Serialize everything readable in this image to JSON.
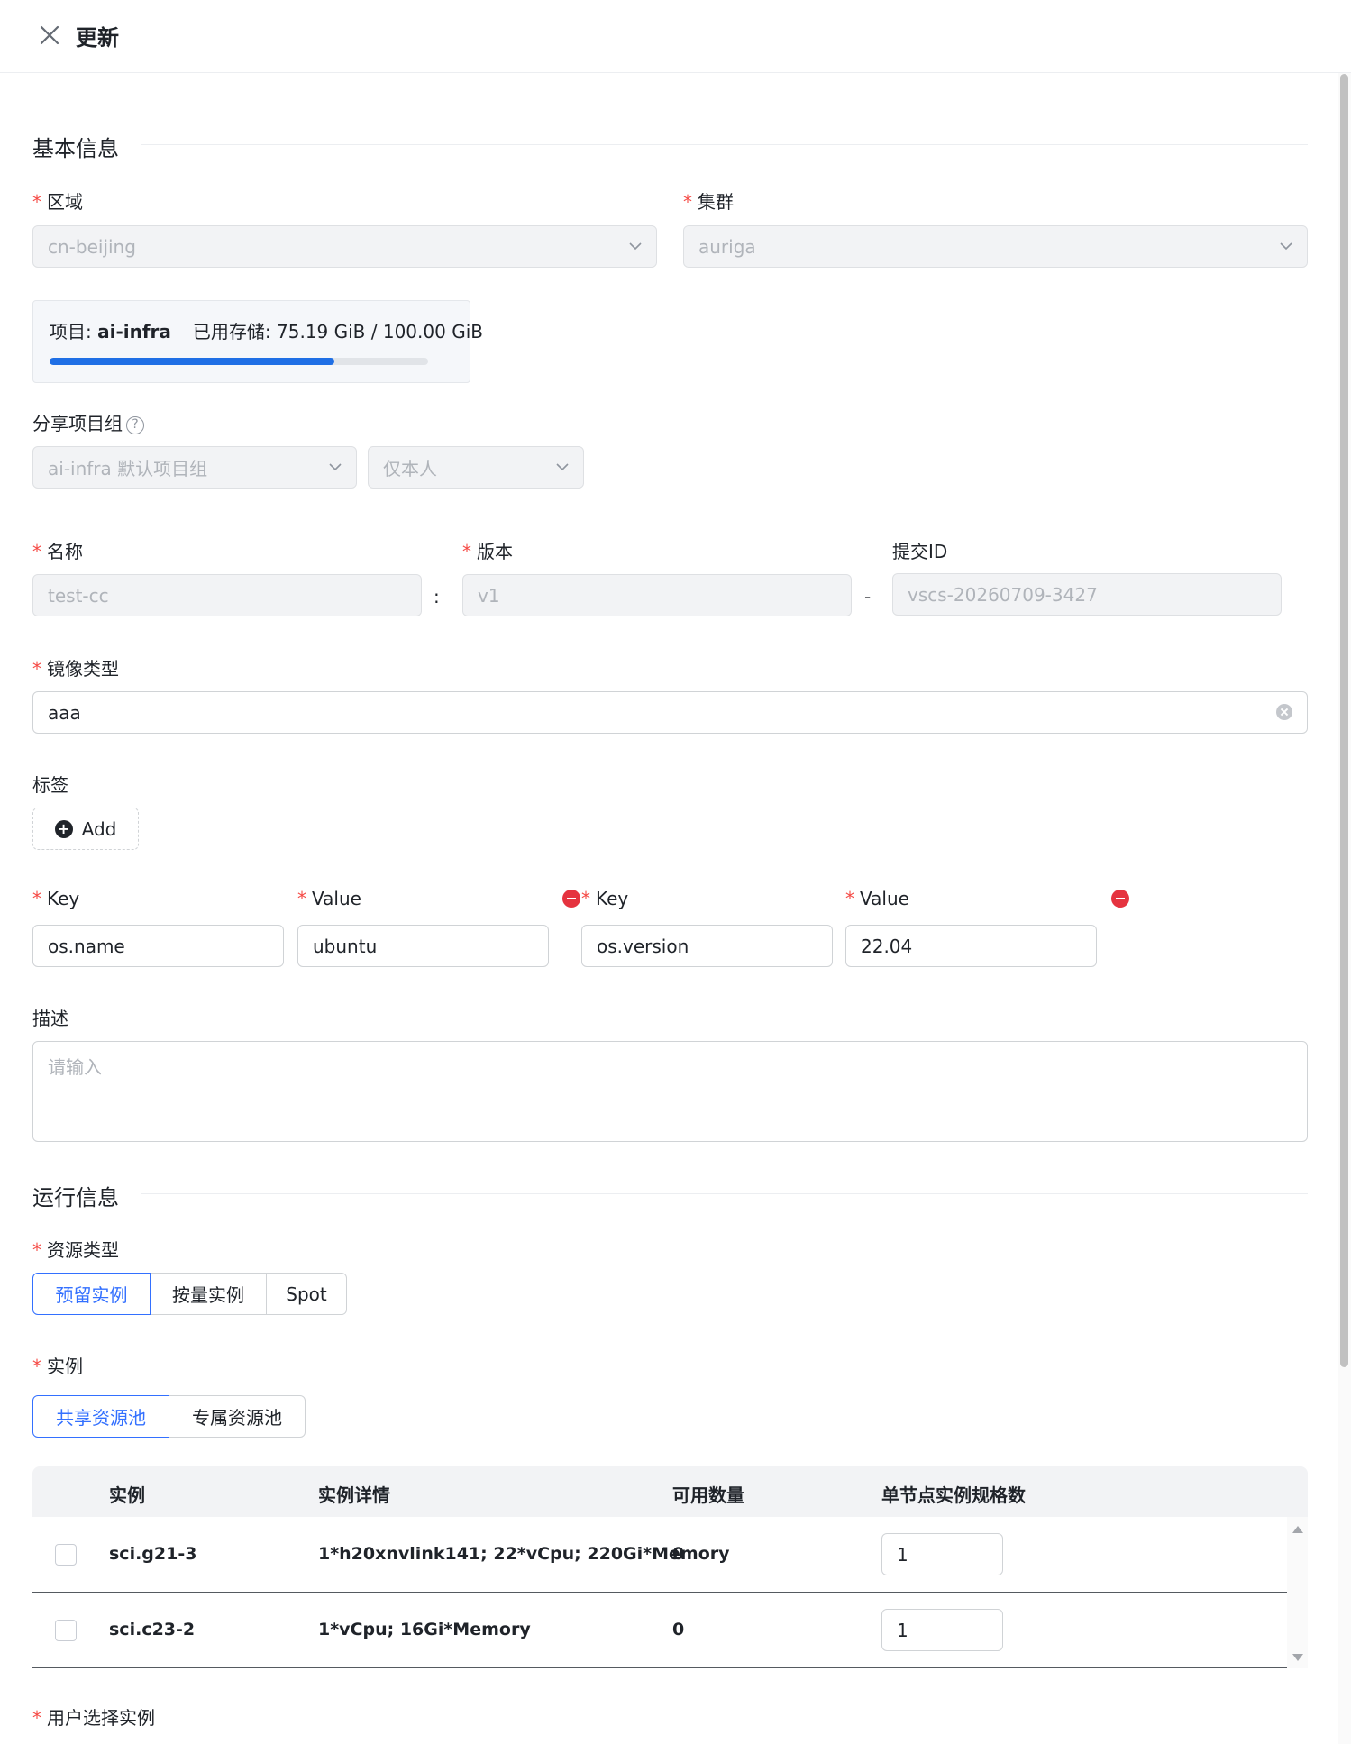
{
  "header": {
    "title": "更新"
  },
  "basic_section": {
    "title": "基本信息"
  },
  "region": {
    "label": "区域",
    "value": "cn-beijing"
  },
  "cluster": {
    "label": "集群",
    "value": "auriga"
  },
  "quota": {
    "project_label": "项目: ",
    "project_name": "ai-infra",
    "storage_text": "已用存储: 75.19 GiB / 100.00 GiB",
    "used_fraction": 0.7519
  },
  "share_group": {
    "label": "分享项目组",
    "group_value": "ai-infra 默认项目组",
    "scope_value": "仅本人"
  },
  "name": {
    "label": "名称",
    "value": "test-cc"
  },
  "version": {
    "label": "版本",
    "value": "v1"
  },
  "commit": {
    "label": "提交ID",
    "value": "vscs-20260709-3427"
  },
  "separators": {
    "colon": ":",
    "dash": "-"
  },
  "image_type": {
    "label": "镜像类型",
    "value": "aaa"
  },
  "tags": {
    "label": "标签",
    "add_label": "Add",
    "key_label": "Key",
    "value_label": "Value",
    "pairs": [
      {
        "key": "os.name",
        "value": "ubuntu"
      },
      {
        "key": "os.version",
        "value": "22.04"
      }
    ]
  },
  "description": {
    "label": "描述",
    "placeholder": "请输入"
  },
  "run_section": {
    "title": "运行信息"
  },
  "resource_type": {
    "label": "资源类型",
    "options": [
      "预留实例",
      "按量实例",
      "Spot"
    ],
    "selected": "预留实例"
  },
  "instance": {
    "label": "实例",
    "pools": [
      "共享资源池",
      "专属资源池"
    ],
    "selected_pool": "共享资源池"
  },
  "instance_table": {
    "columns": [
      "实例",
      "实例详情",
      "可用数量",
      "单节点实例规格数"
    ],
    "rows": [
      {
        "name": "sci.g21-3",
        "detail": "1*h20xnvlink141; 22*vCpu; 220Gi*Memory",
        "available": "0",
        "count": "1"
      },
      {
        "name": "sci.c23-2",
        "detail": "1*vCpu; 16Gi*Memory",
        "available": "0",
        "count": "1"
      }
    ]
  },
  "user_instance": {
    "label": "用户选择实例"
  }
}
